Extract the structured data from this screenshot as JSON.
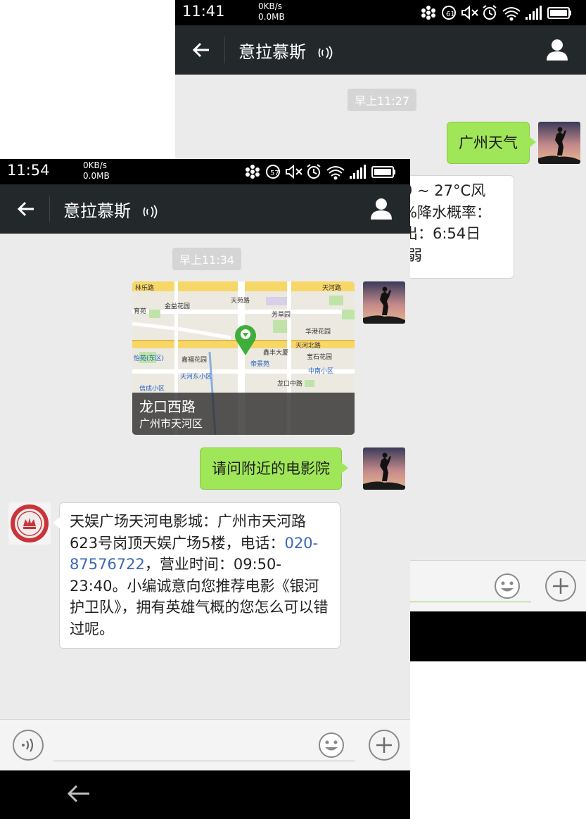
{
  "back_screen": {
    "status": {
      "time": "11:41",
      "net_speed": "0KB/s",
      "net_total": "0.0MB"
    },
    "header": {
      "title": "意拉慕斯"
    },
    "messages": {
      "timestamp": "早上11:27",
      "sent_text": "广州天气",
      "reply_lines": [
        "9 ~ 27°C风",
        "%降水概率：",
        "出：6:54日",
        "弱"
      ]
    }
  },
  "front_screen": {
    "status": {
      "time": "11:54",
      "net_speed": "0KB/s",
      "net_total": "0.0MB"
    },
    "header": {
      "title": "意拉慕斯"
    },
    "messages": {
      "timestamp": "早上11:34",
      "location": {
        "place": "龙口西路",
        "district": "广州市天河区"
      },
      "map_labels": [
        "林乐路",
        "天河路",
        "育苑",
        "芳草园",
        "天河北路",
        "天河东小区",
        "帝景苑",
        "中南小区",
        "信成小区",
        "怡苑(东区)",
        "龙口中路",
        "金益花园",
        "华港花园",
        "嘉福花园",
        "鑫丰大厦",
        "天苑路",
        "宝石花园"
      ],
      "sent_text": "请问附近的电影院",
      "reply_prefix": "天娱广场天河电影城：广州市天河路623号岗顶天娱广场5楼，电话：",
      "reply_phone": "020-87576722",
      "reply_suffix": "，营业时间：09:50-23:40。小编诚意向您推荐电影《银河护卫队》，拥有英雄气概的您怎么可以错过呢。"
    }
  },
  "colors": {
    "bubble_out": "#9fe658",
    "header_bg": "#23282b",
    "link": "#3b67b7",
    "map_pin": "#3fae3a"
  },
  "icons": [
    "back-arrow-icon",
    "voice-mode-icon",
    "profile-icon",
    "emoji-icon",
    "plus-icon",
    "keyboard-voice-icon",
    "wifi-icon",
    "signal-icon",
    "battery-icon",
    "alarm-icon",
    "mute-icon",
    "location-pin-icon"
  ]
}
